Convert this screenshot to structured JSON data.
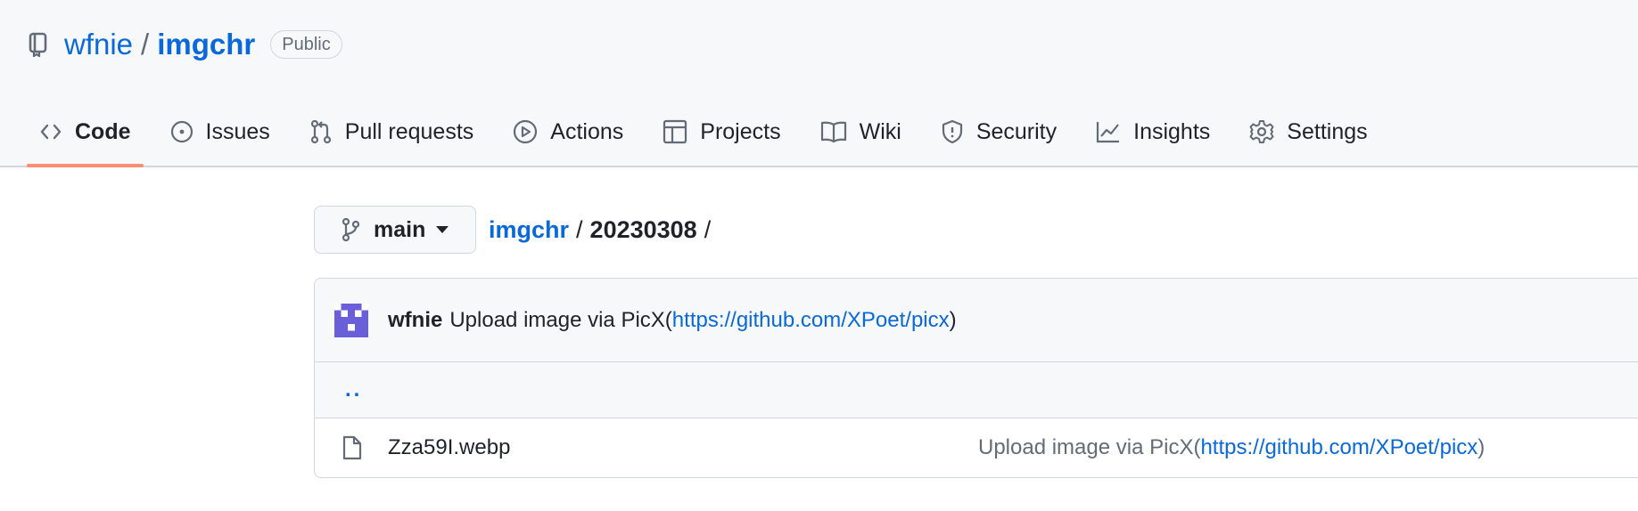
{
  "repo": {
    "owner": "wfnie",
    "separator": "/",
    "name": "imgchr",
    "visibility": "Public",
    "icon": "repo-icon"
  },
  "tabs": [
    {
      "label": "Code",
      "icon": "code-icon",
      "selected": true
    },
    {
      "label": "Issues",
      "icon": "issue-opened-icon"
    },
    {
      "label": "Pull requests",
      "icon": "git-pull-request-icon"
    },
    {
      "label": "Actions",
      "icon": "play-icon"
    },
    {
      "label": "Projects",
      "icon": "table-icon"
    },
    {
      "label": "Wiki",
      "icon": "book-icon"
    },
    {
      "label": "Security",
      "icon": "shield-icon"
    },
    {
      "label": "Insights",
      "icon": "graph-icon"
    },
    {
      "label": "Settings",
      "icon": "gear-icon"
    }
  ],
  "branch": {
    "name": "main",
    "icon": "git-branch-icon"
  },
  "breadcrumb": {
    "root": "imgchr",
    "separator": "/",
    "folder": "20230308",
    "trailing": "/"
  },
  "latest_commit": {
    "author": "wfnie",
    "message_prefix": "Upload image via PicX(",
    "link": "https://github.com/XPoet/picx",
    "message_suffix": ")"
  },
  "parent_dir": "..",
  "files": [
    {
      "name": "Zza59I.webp",
      "icon": "file-icon",
      "commit_prefix": "Upload image via PicX(",
      "commit_link": "https://github.com/XPoet/picx",
      "commit_suffix": ")"
    }
  ],
  "colors": {
    "link": "#0969da",
    "header_bg": "#f6f8fa",
    "border": "#d0d7de",
    "selected_underline": "#fd8c73",
    "muted": "#636c76",
    "avatar": "#6a5fd8"
  }
}
